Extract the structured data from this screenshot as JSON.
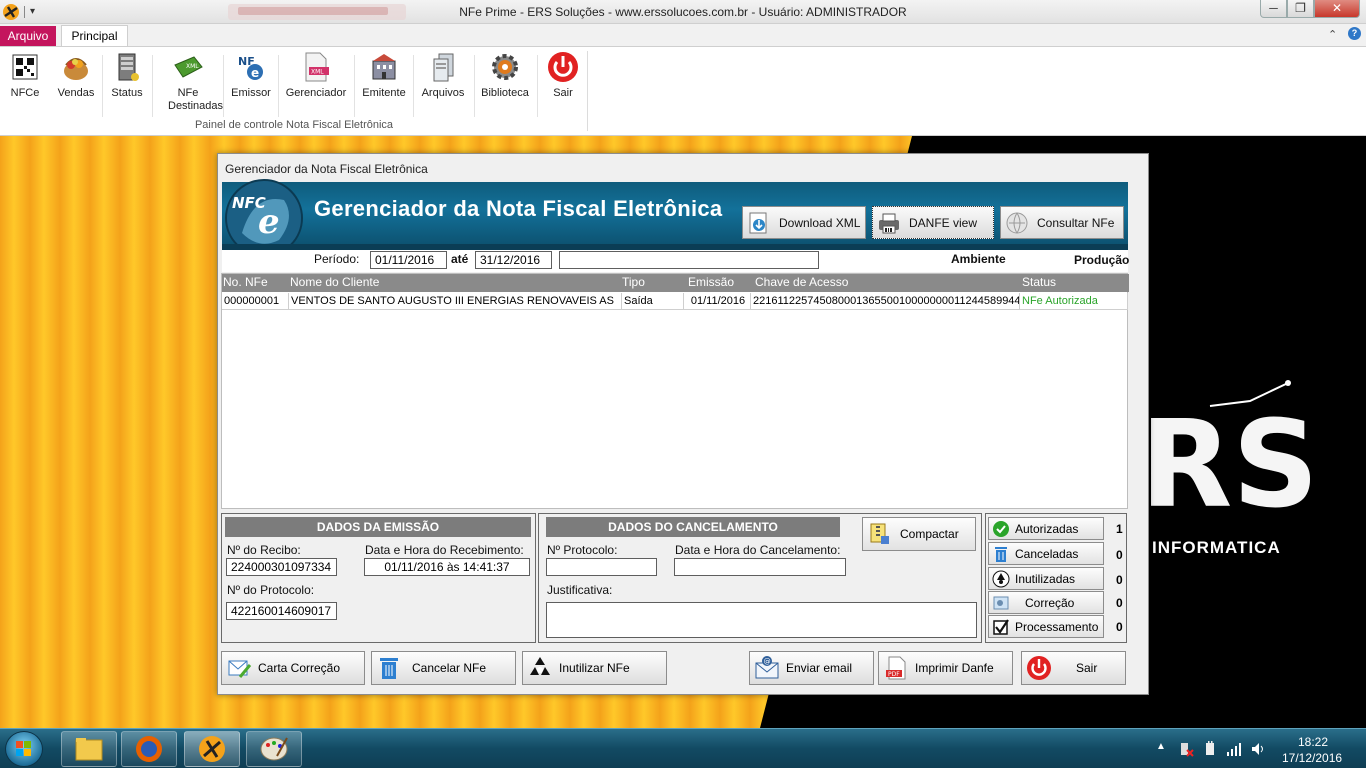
{
  "window": {
    "title": "NFe Prime - ERS Soluções - www.erssolucoes.com.br - Usuário: ADMINISTRADOR",
    "minimize": "─",
    "maximize": "❐",
    "close": "✕"
  },
  "ribbon": {
    "tabs": [
      "Arquivo",
      "Principal"
    ],
    "group_label": "Painel de controle Nota Fiscal Eletrônica",
    "buttons": [
      {
        "label": "NFCe",
        "icon": "qr-code-icon"
      },
      {
        "label": "Vendas",
        "icon": "shopping-basket-icon"
      },
      {
        "label": "Status",
        "icon": "server-icon"
      },
      {
        "label": "NFe Destinadas",
        "icon": "green-ticket-icon"
      },
      {
        "label": "Emissor",
        "icon": "nfe-logo-icon"
      },
      {
        "label": "Gerenciador",
        "icon": "xml-file-icon"
      },
      {
        "label": "Emitente",
        "icon": "building-icon"
      },
      {
        "label": "Arquivos",
        "icon": "files-icon"
      },
      {
        "label": "Biblioteca",
        "icon": "gear-icon"
      },
      {
        "label": "Sair",
        "icon": "power-icon"
      }
    ]
  },
  "desktop": {
    "brand_text": "RS",
    "brand_sub": "INFORMATICA"
  },
  "dialog": {
    "title": "Gerenciador da Nota Fiscal Eletrônica",
    "banner_title": "Gerenciador da Nota Fiscal Eletrônica",
    "logo_text": "NFC",
    "top_buttons": {
      "download_xml": "Download XML",
      "danfe_view": "DANFE view",
      "consultar": "Consultar NFe"
    },
    "filter": {
      "periodo_label": "Período:",
      "date_from": "01/11/2016",
      "ate_label": "até",
      "date_to": "31/12/2016",
      "search_value": "",
      "ambiente_label": "Ambiente",
      "ambiente_value": "Produção"
    },
    "grid": {
      "columns": [
        "No. NFe",
        "Nome do Cliente",
        "Tipo",
        "Emissão",
        "Chave de Acesso",
        "Status"
      ],
      "rows": [
        {
          "numero": "000000001",
          "cliente": "VENTOS DE SANTO AUGUSTO III ENERGIAS RENOVAVEIS AS",
          "tipo": "Saída",
          "emissao": "01/11/2016",
          "chave": "22161122574508000136550010000000011244589944",
          "status": "NFe Autorizada"
        }
      ]
    },
    "emissao": {
      "header": "DADOS DA EMISSÃO",
      "recibo_label": "Nº do Recibo:",
      "recibo_value": "224000301097334",
      "data_label": "Data e Hora do Recebimento:",
      "data_value": "01/11/2016 às 14:41:37",
      "protocolo_label": "Nº do  Protocolo:",
      "protocolo_value": "422160014609017"
    },
    "cancelamento": {
      "header": "DADOS DO CANCELAMENTO",
      "protocolo_label": "Nº Protocolo:",
      "protocolo_value": "",
      "data_label": "Data e Hora do Cancelamento:",
      "data_value": "",
      "justificativa_label": "Justificativa:",
      "justificativa_value": "",
      "compactar": "Compactar"
    },
    "status_summary": [
      {
        "label": "Autorizadas",
        "count": "1",
        "icon": "check-icon"
      },
      {
        "label": "Canceladas",
        "count": "0",
        "icon": "trash-icon"
      },
      {
        "label": "Inutilizadas",
        "count": "0",
        "icon": "recycle-icon"
      },
      {
        "label": "Correção",
        "count": "0",
        "icon": "correction-icon"
      },
      {
        "label": "Processamento",
        "count": "0",
        "icon": "checkbox-icon"
      }
    ],
    "bottom_buttons": {
      "carta": "Carta Correção",
      "cancelar": "Cancelar NFe",
      "inutilizar": "Inutilizar NFe",
      "email": "Enviar email",
      "imprimir": "Imprimir Danfe",
      "sair": "Sair"
    }
  },
  "taskbar": {
    "time": "18:22",
    "date": "17/12/2016"
  }
}
